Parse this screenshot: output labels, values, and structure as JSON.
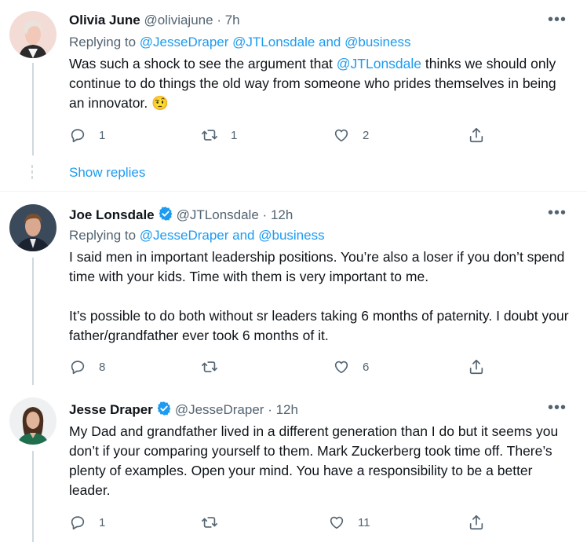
{
  "tweets": [
    {
      "name": "Olivia June",
      "handle": "@oliviajune",
      "dot": "·",
      "time": "7h",
      "replying_prefix": "Replying to",
      "replying_to": "@JesseDraper @JTLonsdale and @business",
      "text_before": "Was such a shock to see the argument that ",
      "text_mention": "@JTLonsdale",
      "text_after": " thinks we should only continue to do things the old way from someone who prides themselves in being an innovator. 🤨",
      "replies": "1",
      "retweets": "1",
      "likes": "2",
      "verified": false
    },
    {
      "name": "Joe Lonsdale",
      "handle": "@JTLonsdale",
      "dot": "·",
      "time": "12h",
      "replying_prefix": "Replying to",
      "replying_to": "@JesseDraper and @business",
      "text_p1": "I said men in important leadership positions. You’re also a loser if you don’t spend time with your kids.  Time with them is very important to me.",
      "text_p2": "It’s possible to do both without sr leaders taking 6 months of paternity.  I doubt your father/grandfather ever took 6 months of it.",
      "replies": "8",
      "retweets": "",
      "likes": "6",
      "verified": true
    },
    {
      "name": "Jesse Draper",
      "handle": "@JesseDraper",
      "dot": "·",
      "time": "12h",
      "text": "My Dad and grandfather lived in a different generation than I do but it seems you don’t if your comparing yourself to them. Mark Zuckerberg took time off. There’s plenty of examples. Open your mind. You have a responsibility to be a better leader.",
      "replies": "1",
      "retweets": "",
      "likes": "11",
      "verified": true
    }
  ],
  "show_replies": "Show replies",
  "more_glyph": "•••",
  "colors": {
    "link": "#1d9bf0",
    "secondary": "#536471",
    "thread_line": "#cfd9de",
    "divider": "#eff3f4"
  },
  "icons": [
    "reply-icon",
    "retweet-icon",
    "like-icon",
    "share-icon",
    "verified-badge-icon",
    "more-icon"
  ]
}
